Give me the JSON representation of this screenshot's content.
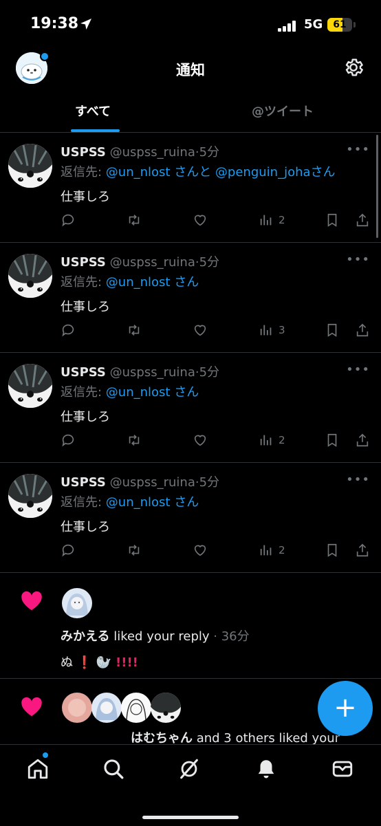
{
  "status_bar": {
    "time": "19:38",
    "network": "5G",
    "battery": "61"
  },
  "header": {
    "title": "通知"
  },
  "tabs": [
    {
      "label": "すべて",
      "active": true
    },
    {
      "label": "@ツイート",
      "active": false
    }
  ],
  "tweets": [
    {
      "name": "USPSS",
      "handle": "@uspss_ruina",
      "dot": "·",
      "time": "5分",
      "reply_prefix": "返信先: ",
      "mentions": "@un_nlost さんと @penguin_johaさん",
      "body": "仕事しろ",
      "views": "2"
    },
    {
      "name": "USPSS",
      "handle": "@uspss_ruina",
      "dot": "·",
      "time": "5分",
      "reply_prefix": "返信先: ",
      "mentions": "@un_nlost さん",
      "body": "仕事しろ",
      "views": "3"
    },
    {
      "name": "USPSS",
      "handle": "@uspss_ruina",
      "dot": "·",
      "time": "5分",
      "reply_prefix": "返信先: ",
      "mentions": "@un_nlost さん",
      "body": "仕事しろ",
      "views": "2"
    },
    {
      "name": "USPSS",
      "handle": "@uspss_ruina",
      "dot": "·",
      "time": "5分",
      "reply_prefix": "返信先: ",
      "mentions": "@un_nlost さん",
      "body": "仕事しろ",
      "views": "2"
    }
  ],
  "notifications": [
    {
      "name": "みかえる",
      "action": " liked your reply",
      "time": " · 36分",
      "content_prefix": "ぬ",
      "content_marks": [
        "❗",
        "!!",
        "!!"
      ]
    },
    {
      "name": "はむちゃん",
      "action": " and 3 others liked your"
    }
  ],
  "icons": {
    "compose": "plus-icon",
    "tabbar": [
      "home-icon",
      "search-icon",
      "grok-icon",
      "bell-icon",
      "mail-icon"
    ]
  },
  "colors": {
    "accent": "#1d9bf0",
    "like": "#f91880",
    "background": "#000000"
  },
  "fab": {
    "label": "+"
  }
}
